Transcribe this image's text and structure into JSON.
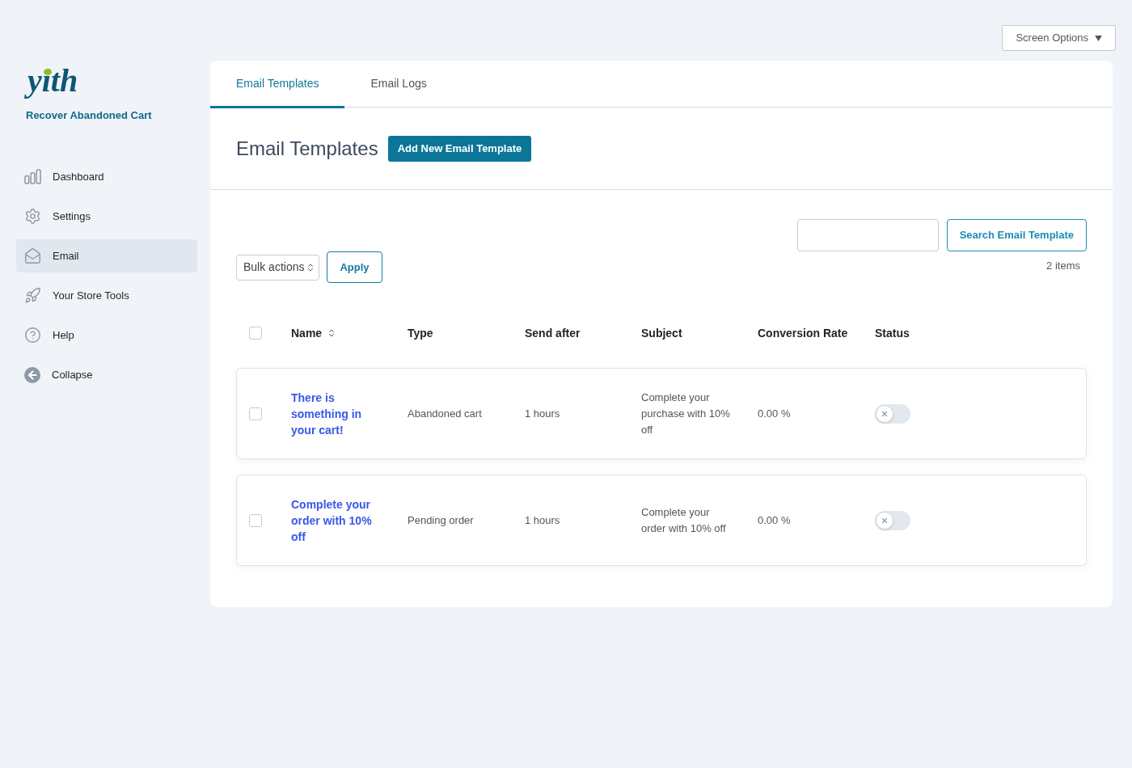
{
  "screen_options": {
    "label": "Screen Options"
  },
  "sidebar": {
    "logo": "yith",
    "product": "Recover Abandoned Cart",
    "items": [
      {
        "label": "Dashboard",
        "selected": false
      },
      {
        "label": "Settings",
        "selected": false
      },
      {
        "label": "Email",
        "selected": true
      },
      {
        "label": "Your Store Tools",
        "selected": false
      },
      {
        "label": "Help",
        "selected": false
      },
      {
        "label": "Collapse",
        "selected": false
      }
    ]
  },
  "tabs": [
    {
      "label": "Email Templates",
      "selected": true
    },
    {
      "label": "Email Logs",
      "selected": false
    }
  ],
  "heading": {
    "title": "Email Templates",
    "add_button": "Add New Email Template"
  },
  "search": {
    "button": "Search Email Template",
    "count": "2 items"
  },
  "bulk_actions": {
    "value": "Bulk actions",
    "apply": "Apply"
  },
  "table": {
    "select_all_checked": false,
    "columns": [
      {
        "label": "Name",
        "sortable": true
      },
      {
        "label": "Type",
        "sortable": false
      },
      {
        "label": "Send after",
        "sortable": false
      },
      {
        "label": "Subject",
        "sortable": false
      },
      {
        "label": "Conversion Rate",
        "sortable": false
      },
      {
        "label": "Status",
        "sortable": false
      }
    ],
    "rows": [
      {
        "checked": false,
        "name": "There is something in your cart!",
        "type": "Abandoned cart",
        "send_after": "1 hours",
        "subject": "Complete your purchase with 10% off",
        "conversion_rate": "0.00 %",
        "enabled": false
      },
      {
        "checked": false,
        "name": "Complete your order with 10% off",
        "type": "Pending order",
        "send_after": "1 hours",
        "subject": "Complete your order with 10% off",
        "conversion_rate": "0.00 %",
        "enabled": false
      }
    ]
  }
}
